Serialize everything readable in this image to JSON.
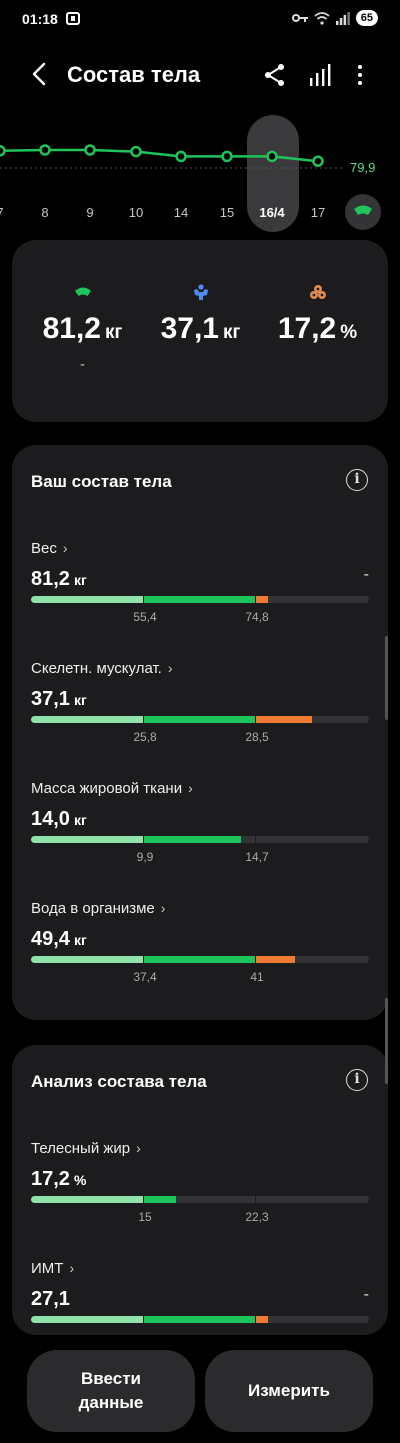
{
  "status": {
    "time": "01:18",
    "battery": "65"
  },
  "header": {
    "title": "Состав тела"
  },
  "trend": {
    "last_value": "79,9",
    "labels": [
      "7",
      "8",
      "9",
      "10",
      "14",
      "15",
      "16/4",
      "17"
    ],
    "selected": "16/4"
  },
  "chart_data": {
    "type": "line",
    "x": [
      "8",
      "9",
      "10",
      "14",
      "15",
      "16/4",
      "17"
    ],
    "series": [
      {
        "values": [
          80.6,
          80.6,
          80.5,
          80.2,
          80.2,
          80.2,
          79.9
        ]
      }
    ],
    "last_label": "79,9"
  },
  "summary": {
    "weight": {
      "value": "81,2",
      "unit": "кг",
      "sub": "-"
    },
    "muscle": {
      "value": "37,1",
      "unit": "кг"
    },
    "fat": {
      "value": "17,2",
      "unit": "%"
    }
  },
  "composition": {
    "title": "Ваш состав тела",
    "metrics": [
      {
        "label": "Вес",
        "value": "81,2",
        "unit": "кг",
        "right": "-",
        "t1": "55,4",
        "t2": "74,8",
        "fill": 0.7
      },
      {
        "label": "Скелетн. мускулат.",
        "value": "37,1",
        "unit": "кг",
        "right": "",
        "t1": "25,8",
        "t2": "28,5",
        "fill": 0.83
      },
      {
        "label": "Масса жировой ткани",
        "value": "14,0",
        "unit": "кг",
        "right": "",
        "t1": "9,9",
        "t2": "14,7",
        "fill": 0.62
      },
      {
        "label": "Вода в организме",
        "value": "49,4",
        "unit": "кг",
        "right": "",
        "t1": "37,4",
        "t2": "41",
        "fill": 0.78
      }
    ]
  },
  "analysis": {
    "title": "Анализ состава тела",
    "metrics": [
      {
        "label": "Телесный жир",
        "value": "17,2",
        "unit": "%",
        "right": "",
        "t1": "15",
        "t2": "22,3",
        "fill": 0.43
      },
      {
        "label": "ИМТ",
        "value": "27,1",
        "unit": "",
        "right": "-",
        "t1": "",
        "t2": "",
        "fill": 0.7
      }
    ]
  },
  "buttons": {
    "enter": "Ввести\nданные",
    "measure": "Измерить"
  },
  "colors": {
    "accent": "#1fc45a",
    "light": "#8fe3a9",
    "high": "#f07a34",
    "muscle": "#4c8df5",
    "fat": "#e0884a"
  }
}
